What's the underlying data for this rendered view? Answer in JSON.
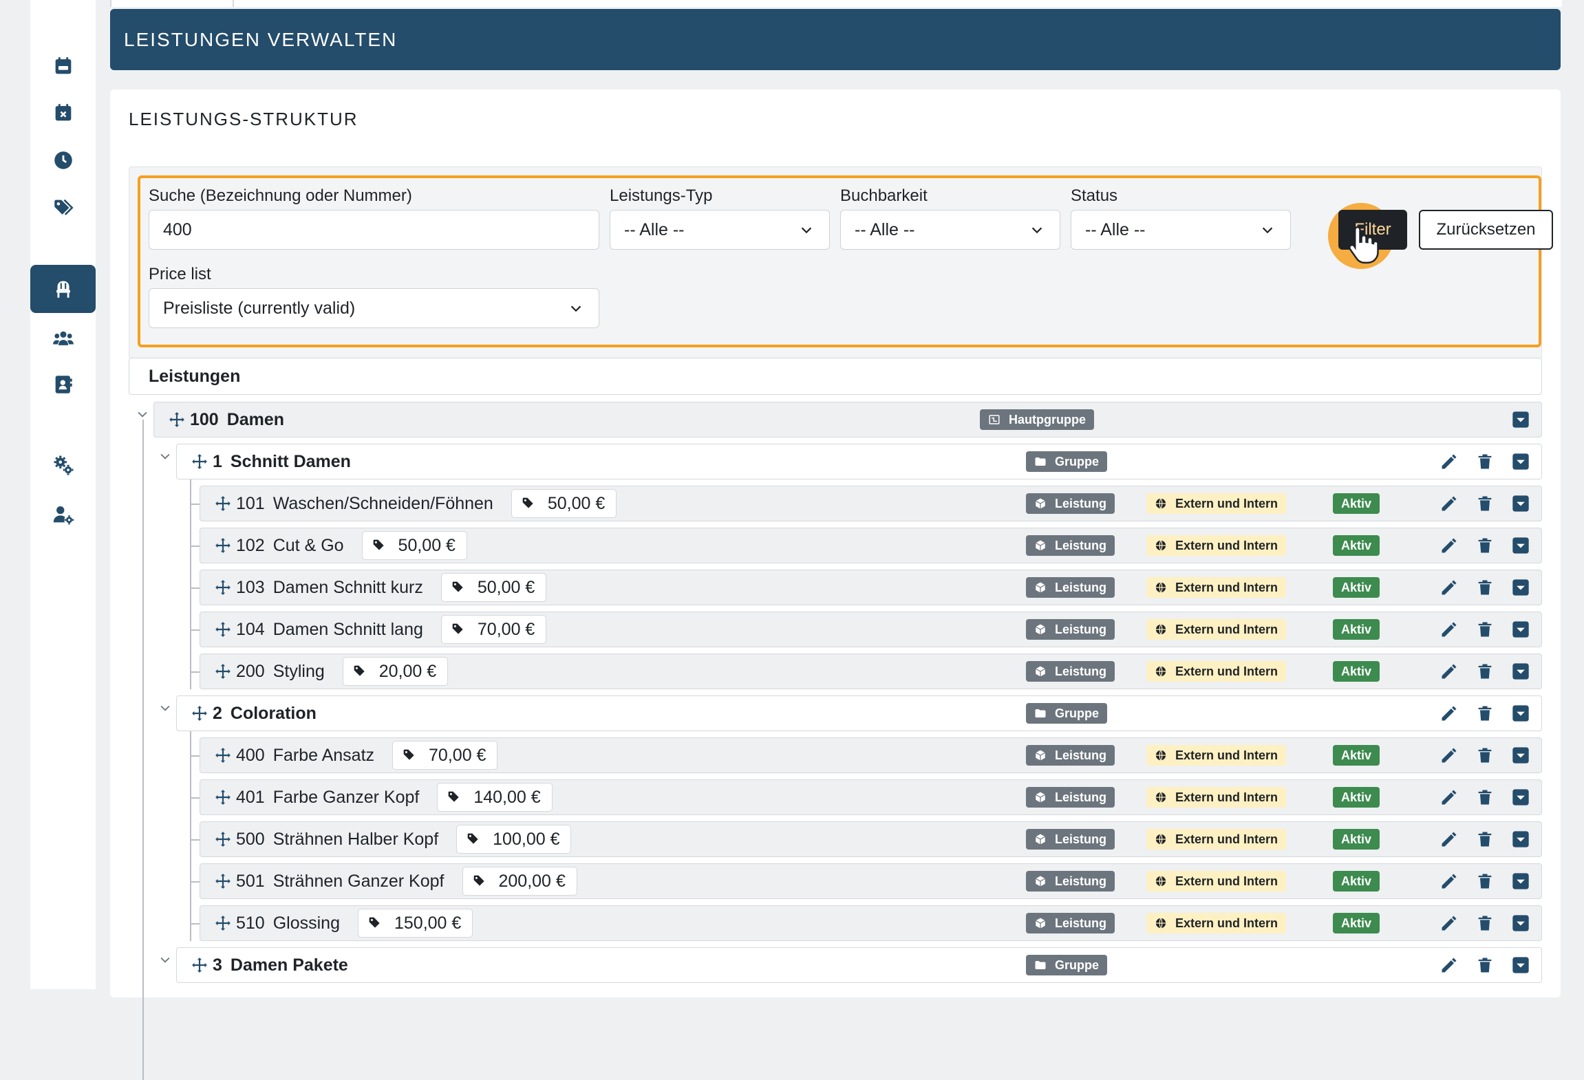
{
  "page": {
    "header_title": "LEISTUNGEN VERWALTEN",
    "card_title": "LEISTUNGS-STRUKTUR"
  },
  "sidebar": {
    "icons": [
      "calendar-icon",
      "calendar-x-icon",
      "clock-icon",
      "tags-icon",
      "chair-icon",
      "users-icon",
      "contact-card-icon",
      "gears-icon",
      "user-gear-icon"
    ],
    "active": "chair-icon"
  },
  "filters": {
    "search_label": "Suche (Bezeichnung oder Nummer)",
    "search_value": "400",
    "type_label": "Leistungs-Typ",
    "type_value": "-- Alle --",
    "bookable_label": "Buchbarkeit",
    "bookable_value": "-- Alle --",
    "status_label": "Status",
    "status_value": "-- Alle --",
    "pricelist_label": "Price list",
    "pricelist_value": "Preisliste (currently valid)",
    "filter_button": "Filter",
    "reset_button": "Zurücksetzen"
  },
  "tree": {
    "header": "Leistungen",
    "main_group": {
      "number": "100",
      "name": "Damen",
      "badge": "Hautpgruppe"
    },
    "groups": [
      {
        "number": "1",
        "name": "Schnitt Damen",
        "badge": "Gruppe",
        "items": [
          {
            "number": "101",
            "name": "Waschen/Schneiden/Föhnen",
            "price": "50,00 €"
          },
          {
            "number": "102",
            "name": "Cut & Go",
            "price": "50,00 €"
          },
          {
            "number": "103",
            "name": "Damen Schnitt kurz",
            "price": "50,00 €"
          },
          {
            "number": "104",
            "name": "Damen Schnitt lang",
            "price": "70,00 €"
          },
          {
            "number": "200",
            "name": "Styling",
            "price": "20,00 €"
          }
        ]
      },
      {
        "number": "2",
        "name": "Coloration",
        "badge": "Gruppe",
        "items": [
          {
            "number": "400",
            "name": "Farbe Ansatz",
            "price": "70,00 €"
          },
          {
            "number": "401",
            "name": "Farbe Ganzer Kopf",
            "price": "140,00 €"
          },
          {
            "number": "500",
            "name": "Strähnen Halber Kopf",
            "price": "100,00 €"
          },
          {
            "number": "501",
            "name": "Strähnen Ganzer Kopf",
            "price": "200,00 €"
          },
          {
            "number": "510",
            "name": "Glossing",
            "price": "150,00 €"
          }
        ]
      },
      {
        "number": "3",
        "name": "Damen Pakete",
        "badge": "Gruppe",
        "items": []
      }
    ],
    "item_type_badge": "Leistung",
    "item_visibility_badge": "Extern und Intern",
    "item_status_badge": "Aktiv"
  },
  "colors": {
    "brand": "#244c6b",
    "highlight": "#f5a021",
    "active_badge": "#3d8b4f",
    "type_badge": "#6c757d",
    "visibility_badge": "#fdf0c2"
  }
}
